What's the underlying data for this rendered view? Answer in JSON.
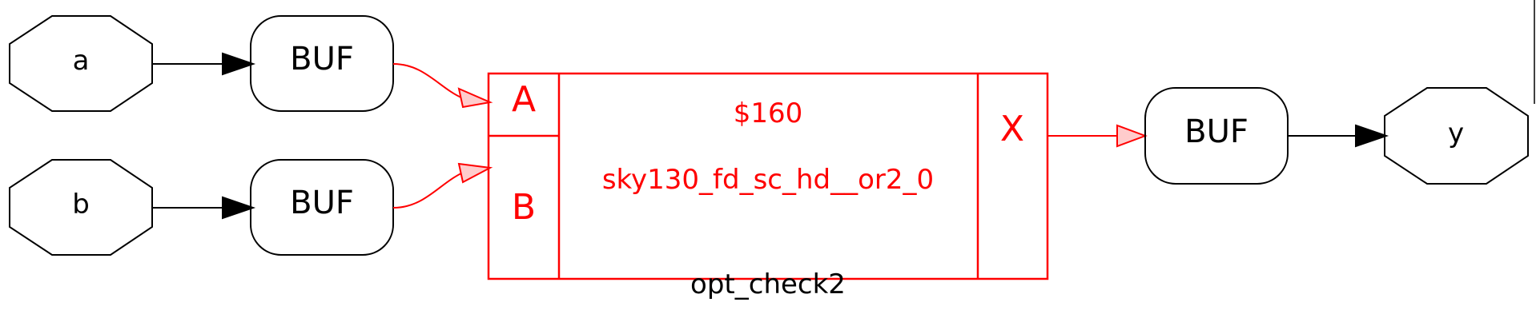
{
  "diagram": {
    "title": "opt_check2",
    "inputs": [
      {
        "label": "a"
      },
      {
        "label": "b"
      }
    ],
    "output": {
      "label": "y"
    },
    "buffers": [
      {
        "label": "BUF"
      },
      {
        "label": "BUF"
      },
      {
        "label": "BUF"
      }
    ],
    "cell": {
      "id": "$160",
      "type": "sky130_fd_sc_hd__or2_0",
      "in_ports": [
        "A",
        "B"
      ],
      "out_port": "X"
    },
    "colors": {
      "highlight": "#ff0000",
      "arrow_fill_highlight": "#ffcccc",
      "normal": "#000000"
    }
  }
}
